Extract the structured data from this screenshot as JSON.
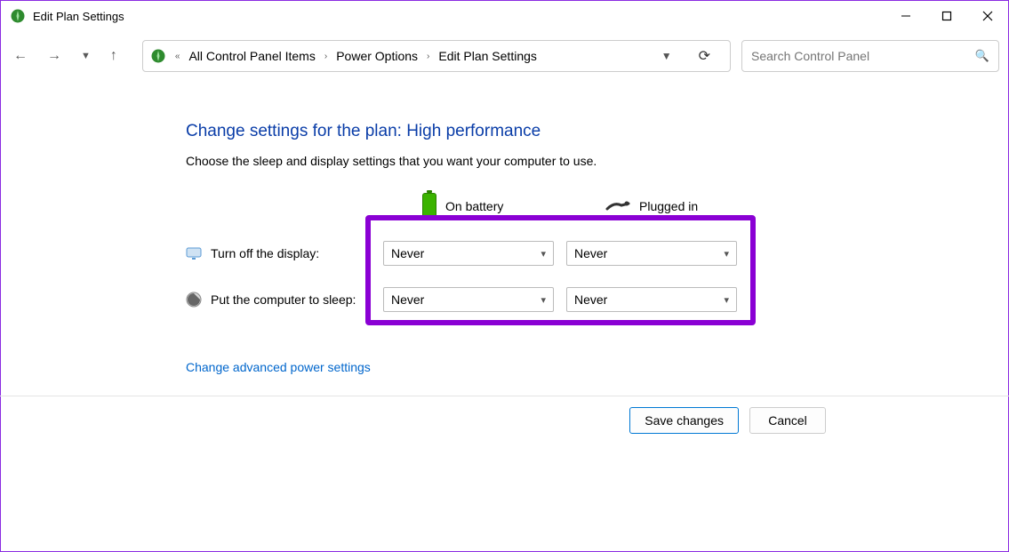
{
  "window": {
    "title": "Edit Plan Settings"
  },
  "breadcrumb": {
    "items": [
      "All Control Panel Items",
      "Power Options",
      "Edit Plan Settings"
    ]
  },
  "search": {
    "placeholder": "Search Control Panel"
  },
  "page": {
    "heading": "Change settings for the plan: High performance",
    "subtext": "Choose the sleep and display settings that you want your computer to use."
  },
  "columns": {
    "battery": "On battery",
    "plugged": "Plugged in"
  },
  "rows": {
    "display_label": "Turn off the display:",
    "sleep_label": "Put the computer to sleep:",
    "display_battery": "Never",
    "display_plugged": "Never",
    "sleep_battery": "Never",
    "sleep_plugged": "Never"
  },
  "links": {
    "advanced": "Change advanced power settings"
  },
  "buttons": {
    "save": "Save changes",
    "cancel": "Cancel"
  }
}
